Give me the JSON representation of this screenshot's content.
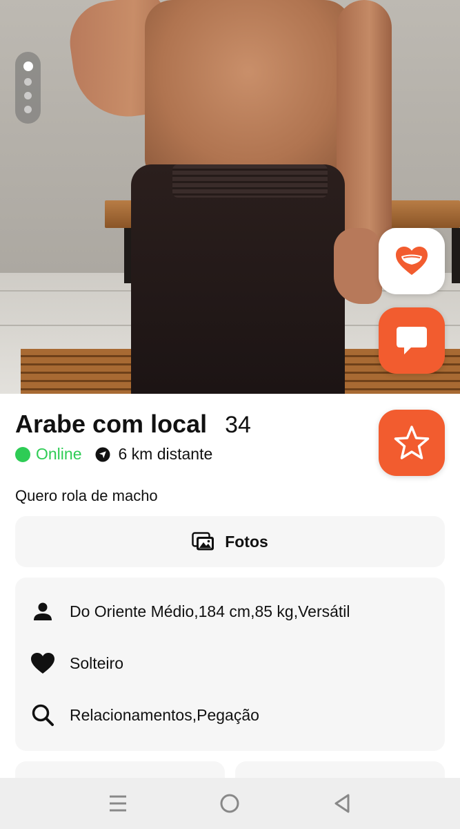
{
  "profile": {
    "name": "Arabe com local",
    "age": "34",
    "status": "Online",
    "distance": "6 km distante",
    "bio": "Quero rola de macho"
  },
  "photos_button": {
    "label": "Fotos",
    "icon": "photos-icon"
  },
  "details": [
    {
      "icon": "person-icon",
      "text": "Do Oriente Médio,184 cm,85 kg,Versátil"
    },
    {
      "icon": "heart-icon",
      "text": "Solteiro"
    },
    {
      "icon": "search-icon",
      "text": "Relacionamentos,Pegação"
    }
  ],
  "photo_gallery": {
    "total": 4,
    "current": 1
  },
  "actions": {
    "like_icon": "smile-heart-icon",
    "chat_icon": "chat-bubble-icon",
    "favorite_icon": "star-icon"
  },
  "navigation": [
    "menu-icon",
    "home-icon",
    "back-icon"
  ],
  "colors": {
    "accent": "#f25c2f",
    "online": "#2ecc55",
    "card": "#f6f6f6"
  }
}
